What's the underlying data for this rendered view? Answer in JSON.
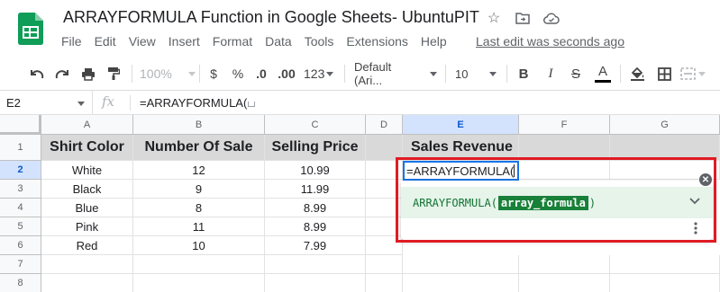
{
  "app": {
    "title": "ARRAYFORMULA Function in Google Sheets- UbuntuPIT",
    "last_edit": "Last edit was seconds ago",
    "icons": [
      "star-icon",
      "move-to-folder-icon",
      "cloud-status-icon"
    ]
  },
  "menu": [
    "File",
    "Edit",
    "View",
    "Insert",
    "Format",
    "Data",
    "Tools",
    "Extensions",
    "Help"
  ],
  "toolbar": {
    "zoom": "100%",
    "currency": "$",
    "percent": "%",
    "decrease_decimals": ".0",
    "increase_decimals": ".00",
    "more_formats": "123",
    "font": "Default (Ari...",
    "font_size": "10",
    "bold": "B",
    "italic": "I",
    "strikethrough": "S",
    "text_color": "A",
    "text_color_value": "#000000"
  },
  "formula_bar": {
    "name_box": "E2",
    "fx": "fx",
    "formula": "=ARRAYFORMULA("
  },
  "grid": {
    "columns": [
      "A",
      "B",
      "C",
      "D",
      "E",
      "F",
      "G"
    ],
    "rows": [
      "1",
      "2",
      "3",
      "4",
      "5",
      "6",
      "7",
      "8"
    ],
    "active_column": "E",
    "active_row": "2",
    "headers": {
      "a": "Shirt Color",
      "b": "Number Of Sale",
      "c": "Selling Price",
      "e": "Sales Revenue"
    },
    "data": [
      {
        "color": "White",
        "sales": "12",
        "price": "10.99"
      },
      {
        "color": "Black",
        "sales": "9",
        "price": "11.99"
      },
      {
        "color": "Blue",
        "sales": "8",
        "price": "8.99"
      },
      {
        "color": "Pink",
        "sales": "11",
        "price": "8.99"
      },
      {
        "color": "Red",
        "sales": "10",
        "price": "7.99"
      }
    ],
    "header_fill": "#d9d9d9"
  },
  "editor": {
    "text": "=ARRAYFORMULA("
  },
  "autocomplete": {
    "function_name": "ARRAYFORMULA(",
    "argument": "array_formula",
    "closing": ")",
    "highlight_color": "#e01b24"
  }
}
